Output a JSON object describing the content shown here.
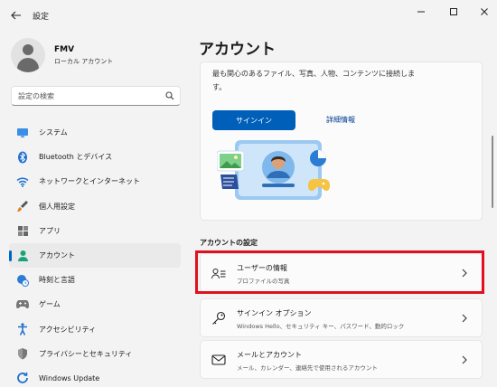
{
  "window": {
    "title": "設定",
    "controls": {
      "minimize": "minimize-icon",
      "maximize": "maximize-icon",
      "close": "close-icon"
    }
  },
  "profile": {
    "name": "FMV",
    "type": "ローカル アカウント"
  },
  "search": {
    "placeholder": "設定の検索"
  },
  "sidebar": {
    "items": [
      {
        "label": "システム",
        "icon": "monitor-icon",
        "active": false
      },
      {
        "label": "Bluetooth とデバイス",
        "icon": "bluetooth-icon",
        "active": false
      },
      {
        "label": "ネットワークとインターネット",
        "icon": "wifi-icon",
        "active": false
      },
      {
        "label": "個人用設定",
        "icon": "brush-icon",
        "active": false
      },
      {
        "label": "アプリ",
        "icon": "apps-icon",
        "active": false
      },
      {
        "label": "アカウント",
        "icon": "account-icon",
        "active": true
      },
      {
        "label": "時刻と言語",
        "icon": "globe-clock-icon",
        "active": false
      },
      {
        "label": "ゲーム",
        "icon": "gamepad-icon",
        "active": false
      },
      {
        "label": "アクセシビリティ",
        "icon": "accessibility-icon",
        "active": false
      },
      {
        "label": "プライバシーとセキュリティ",
        "icon": "shield-icon",
        "active": false
      },
      {
        "label": "Windows Update",
        "icon": "update-icon",
        "active": false
      }
    ]
  },
  "main": {
    "title": "アカウント",
    "signin_card": {
      "description": "最も関心のあるファイル、写真、人物、コンテンツに接続します。",
      "signin_button": "サインイン",
      "details_link": "詳細情報"
    },
    "section_title": "アカウントの設定",
    "rows": [
      {
        "title": "ユーザーの情報",
        "subtitle": "プロファイルの写真",
        "icon": "user-info-icon"
      },
      {
        "title": "サインイン オプション",
        "subtitle": "Windows Hello、セキュリティ キー、パスワード、動的ロック",
        "icon": "key-icon"
      },
      {
        "title": "メールとアカウント",
        "subtitle": "メール、カレンダー、連絡先で使用されるアカウント",
        "icon": "mail-icon"
      }
    ]
  },
  "colors": {
    "accent": "#005fb8",
    "highlight": "#e0101e",
    "background": "#f3f3f3",
    "card": "#fbfbfb"
  }
}
